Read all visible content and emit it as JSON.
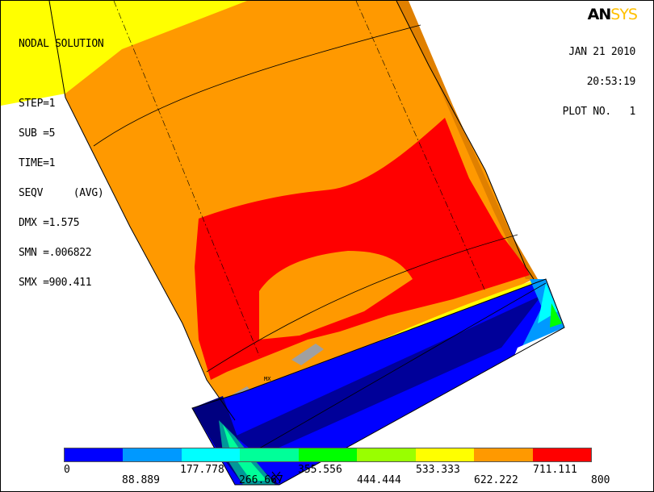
{
  "app": {
    "logo_prefix": "AN",
    "logo_suffix": "SYS"
  },
  "info": {
    "lines": [
      "NODAL SOLUTION",
      "",
      "STEP=1",
      "SUB =5",
      "TIME=1",
      "SEQV     (AVG)",
      "DMX =1.575",
      "SMN =.006822",
      "SMX =900.411"
    ]
  },
  "plot_header": {
    "date": "JAN 21 2010",
    "time": "20:53:19",
    "plot_no": "PLOT NO.   1"
  },
  "markers": {
    "max_label": "MX"
  },
  "legend": {
    "colors": [
      "#0000ff",
      "#0099ff",
      "#00ffff",
      "#00ff99",
      "#00ff00",
      "#99ff00",
      "#ffff00",
      "#ff9900",
      "#ff0000"
    ],
    "labels_top": [
      "0",
      "177.778",
      "355.556",
      "533.333",
      "711.111"
    ],
    "labels_bottom": [
      "88.889",
      "266.667",
      "444.444",
      "622.222",
      "800"
    ]
  }
}
